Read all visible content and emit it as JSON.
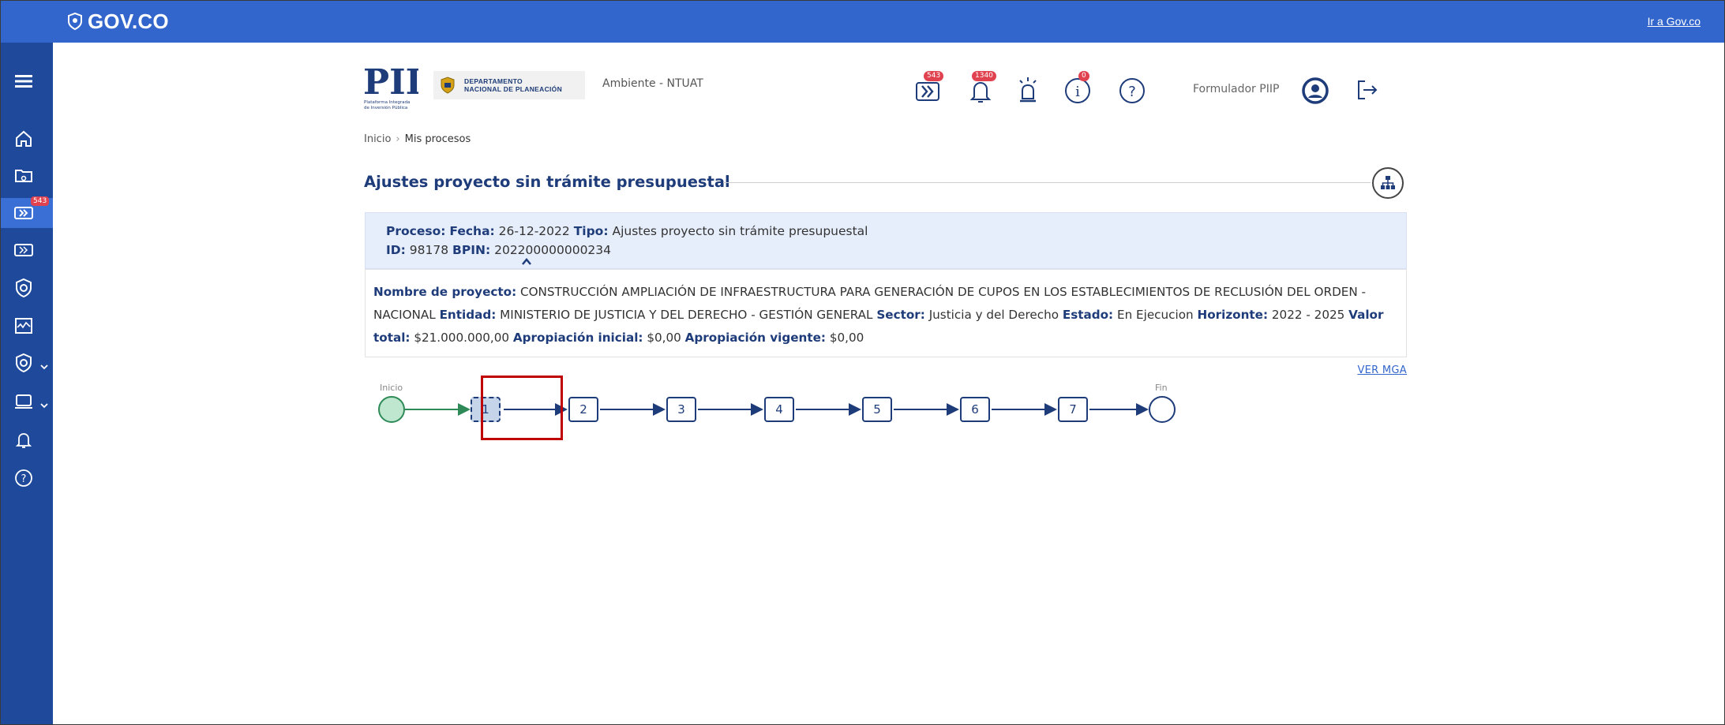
{
  "topbar": {
    "logo_text": "GOV.CO",
    "link": "Ir a Gov.co",
    "color": "#3366cc"
  },
  "sidebar": {
    "items": [
      {
        "icon": "menu-icon"
      },
      {
        "icon": "home-icon"
      },
      {
        "icon": "folder-search-icon"
      },
      {
        "icon": "process-icon",
        "badge": "543",
        "active": true
      },
      {
        "icon": "process-alt-icon"
      },
      {
        "icon": "shield-icon"
      },
      {
        "icon": "monitor-chart-icon"
      },
      {
        "icon": "shield-dropdown-icon",
        "chevron": true
      },
      {
        "icon": "laptop-icon",
        "chevron": true
      },
      {
        "icon": "bell-icon"
      },
      {
        "icon": "help-icon"
      }
    ]
  },
  "header": {
    "logo_alt_line1": "Plataforma Integrada",
    "logo_alt_line2": "de Inversión Pública",
    "dnp_line1": "DEPARTAMENTO",
    "dnp_line2": "NACIONAL DE PLANEACIÓN",
    "environment": "Ambiente - NTUAT",
    "icons": [
      {
        "name": "processes-icon",
        "badge": "543"
      },
      {
        "name": "notifications-icon",
        "badge": "1340"
      },
      {
        "name": "alarm-icon",
        "badge": ""
      },
      {
        "name": "info-icon",
        "badge": "0"
      },
      {
        "name": "help-icon",
        "badge": ""
      }
    ],
    "user": "Formulador PIIP"
  },
  "breadcrumb": {
    "home": "Inicio",
    "separator": "›",
    "current": "Mis procesos"
  },
  "page": {
    "title": "Ajustes proyecto sin trámite presupuestal",
    "process": {
      "proceso_label": "Proceso:",
      "fecha_label": "Fecha:",
      "fecha": "26-12-2022",
      "tipo_label": "Tipo:",
      "tipo": "Ajustes proyecto sin trámite presupuestal",
      "id_label": "ID:",
      "id": "98178",
      "bpin_label": "BPIN:",
      "bpin": "202200000000234"
    },
    "details": {
      "nombre_label": "Nombre de proyecto:",
      "nombre": "CONSTRUCCIÓN AMPLIACIÓN DE INFRAESTRUCTURA PARA GENERACIÓN DE CUPOS EN LOS ESTABLECIMIENTOS DE RECLUSIÓN DEL ORDEN - NACIONAL",
      "entidad_label": "Entidad:",
      "entidad": "MINISTERIO DE JUSTICIA Y DEL DERECHO - GESTIÓN GENERAL",
      "sector_label": "Sector:",
      "sector": "Justicia y del Derecho",
      "estado_label": "Estado:",
      "estado": "En Ejecucion",
      "horizonte_label": "Horizonte:",
      "horizonte": "2022 - 2025",
      "valor_label": "Valor total:",
      "valor": "$21.000.000,00",
      "apropiacion_inicial_label": "Apropiación inicial:",
      "apropiacion_inicial": "$0,00",
      "apropiacion_vigente_label": "Apropiación vigente:",
      "apropiacion_vigente": "$0,00"
    },
    "ver_mga": "VER MGA"
  },
  "stepper": {
    "start_label": "Inicio",
    "end_label": "Fin",
    "steps": [
      "1",
      "2",
      "3",
      "4",
      "5",
      "6",
      "7"
    ],
    "current_step": "1"
  }
}
